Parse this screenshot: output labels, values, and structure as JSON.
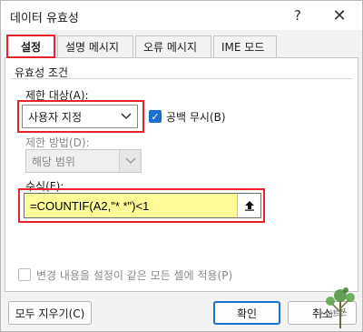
{
  "window": {
    "title": "데이터 유효성",
    "help_glyph": "?",
    "close_glyph": "✕"
  },
  "tabs": [
    {
      "label": "설정",
      "active": true
    },
    {
      "label": "설명 메시지",
      "active": false
    },
    {
      "label": "오류 메시지",
      "active": false
    },
    {
      "label": "IME 모드",
      "active": false
    }
  ],
  "settings": {
    "group_title": "유효성 조건",
    "allow_label": "제한 대상(A):",
    "allow_value": "사용자 지정",
    "ignore_blank_label": "공백 무시(B)",
    "ignore_blank_checked": true,
    "data_label": "제한 방법(D):",
    "data_value": "해당 범위",
    "formula_label": "수식(F):",
    "formula_value": "=COUNTIF(A2,\"* *\")<1",
    "apply_all_label": "변경 내용을 설정이 같은 모든 셀에 적용(P)",
    "apply_all_checked": false
  },
  "buttons": {
    "clear_all": "모두 지우기(C)",
    "ok": "확인",
    "cancel": "취소"
  },
  "colors": {
    "highlight_box": "#e8232d",
    "formula_highlight": "#fffc97",
    "accent": "#1a6fd1"
  },
  "watermark": "스마트폰"
}
